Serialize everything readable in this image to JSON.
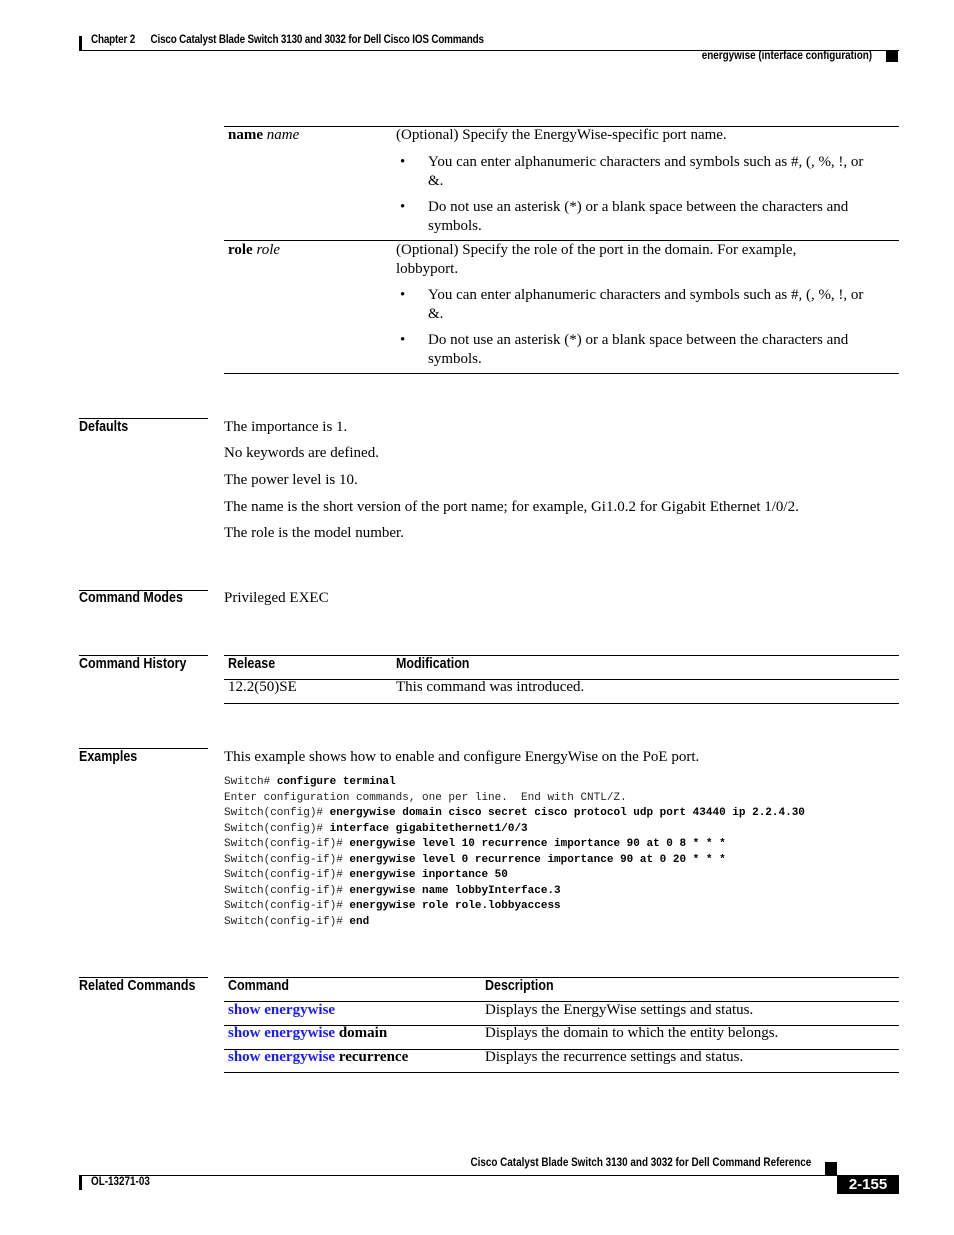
{
  "header": {
    "chapter": "Chapter 2      Cisco Catalyst Blade Switch 3130 and 3032 for Dell Cisco IOS Commands",
    "section": "energywise (interface configuration)"
  },
  "syntax_table": {
    "rows": [
      {
        "keyword": "name",
        "argument": "name",
        "description": "(Optional) Specify the EnergyWise-specific port name.",
        "description_line2": "",
        "bullets": [
          {
            "line1": "You can enter alphanumeric characters and symbols such as #, (, %, !, or",
            "line2": "&."
          },
          {
            "line1": "Do not use an asterisk (*) or a blank space between the characters and",
            "line2": "symbols."
          }
        ]
      },
      {
        "keyword": "role",
        "argument": "role",
        "description": "(Optional) Specify the role of the port in the domain. For example,",
        "description_line2": "lobbyport.",
        "bullets": [
          {
            "line1": "You can enter alphanumeric characters and symbols such as #, (, %, !, or",
            "line2": "&."
          },
          {
            "line1": "Do not use an asterisk (*) or a blank space between the characters and",
            "line2": "symbols."
          }
        ]
      }
    ],
    "bullet_glyph": "•"
  },
  "defaults": {
    "title": "Defaults",
    "lines": [
      "The importance is 1.",
      "No keywords are defined.",
      "The power level is 10.",
      "The name is the short version of the port name; for example, Gi1.0.2 for Gigabit Ethernet 1/0/2.",
      "The role is the model number."
    ]
  },
  "command_modes": {
    "title": "Command Modes",
    "value": "Privileged EXEC"
  },
  "command_history": {
    "title": "Command History",
    "headers": [
      "Release",
      "Modification"
    ],
    "rows": [
      [
        "12.2(50)SE",
        "This command was introduced."
      ]
    ]
  },
  "examples": {
    "title": "Examples",
    "intro": "This example shows how to enable and configure EnergyWise on the PoE port.",
    "code_lines": [
      {
        "prompt": "Switch# ",
        "cmd": "configure terminal"
      },
      {
        "prompt": "Enter configuration commands, one per line.  End with CNTL/Z.",
        "cmd": ""
      },
      {
        "prompt": "Switch(config)# ",
        "cmd": "energywise domain cisco secret cisco protocol udp port 43440 ip 2.2.4.30"
      },
      {
        "prompt": "Switch(config)# ",
        "cmd": "interface gigabitethernet1/0/3"
      },
      {
        "prompt": "Switch(config-if)# ",
        "cmd": "energywise level 10 recurrence importance 90 at 0 8 * * *"
      },
      {
        "prompt": "Switch(config-if)# ",
        "cmd": "energywise level 0 recurrence importance 90 at 0 20 * * *"
      },
      {
        "prompt": "Switch(config-if)# ",
        "cmd": "energywise inportance 50"
      },
      {
        "prompt": "Switch(config-if)# ",
        "cmd": "energywise name lobbyInterface.3"
      },
      {
        "prompt": "Switch(config-if)# ",
        "cmd": "energywise role role.lobbyaccess"
      },
      {
        "prompt": "Switch(config-if)# ",
        "cmd": "end"
      }
    ]
  },
  "related_commands": {
    "title": "Related Commands",
    "headers": [
      "Command",
      "Description"
    ],
    "rows": [
      {
        "link": "show energywise",
        "suffix": "",
        "description": "Displays the EnergyWise settings and status."
      },
      {
        "link": "show energywise",
        "suffix": " domain",
        "description": "Displays the domain to which the entity belongs."
      },
      {
        "link": "show energywise",
        "suffix": " recurrence",
        "description": "Displays the recurrence settings and status."
      }
    ],
    "link_color": "#1a1aff"
  },
  "footer": {
    "title": "Cisco Catalyst Blade Switch 3130 and 3032 for Dell Command Reference",
    "doc_number": "OL-13271-03",
    "page": "2-155"
  }
}
